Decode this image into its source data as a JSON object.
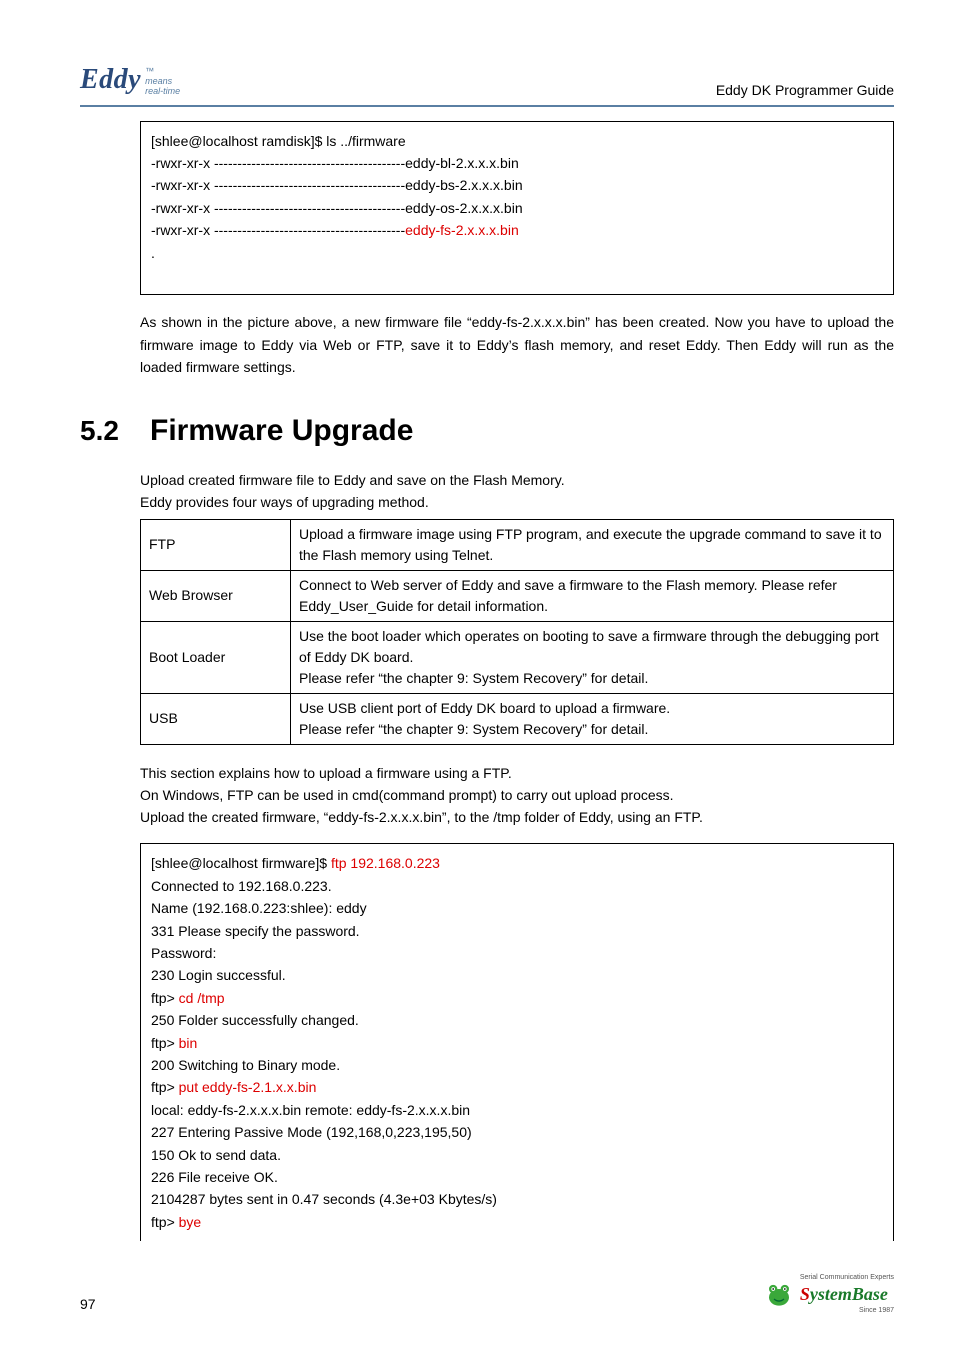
{
  "header": {
    "logo_main": "Eddy",
    "logo_tm": "™",
    "logo_sub1": "means",
    "logo_sub2": "real-time",
    "doc_title": "Eddy DK Programmer Guide"
  },
  "code1": {
    "l1": "[shlee@localhost ramdisk]$ ls ../firmware",
    "l2": "-rwxr-xr-x -----------------------------------------eddy-bl-2.x.x.x.bin",
    "l3": "-rwxr-xr-x -----------------------------------------eddy-bs-2.x.x.x.bin",
    "l4": "-rwxr-xr-x -----------------------------------------eddy-os-2.x.x.x.bin",
    "l5a": "-rwxr-xr-x -----------------------------------------",
    "l5b": "eddy-fs-2.x.x.x.bin",
    "l6": "."
  },
  "para1": "As shown in the picture above, a new firmware file “eddy-fs-2.x.x.x.bin” has been created. Now you have to upload the firmware image to Eddy via Web or FTP, save it to Eddy’s flash memory, and reset Eddy. Then Eddy will run as the loaded firmware settings.",
  "section": {
    "num": "5.2",
    "title": "Firmware Upgrade"
  },
  "intro1": "Upload created firmware file to Eddy and save on the Flash Memory.",
  "intro2": "Eddy provides four ways of upgrading method.",
  "table": {
    "r1k": "FTP",
    "r1v": "Upload a firmware image using FTP program, and execute the upgrade command to save it to the Flash memory using Telnet.",
    "r2k": "Web Browser",
    "r2v": "Connect to Web server of Eddy and save a firmware to the Flash memory. Please refer Eddy_User_Guide for detail information.",
    "r3k": "Boot Loader",
    "r3v": "Use the boot loader which operates on booting to save a firmware through the debugging port of Eddy DK board.\nPlease refer “the chapter 9: System Recovery” for detail.",
    "r4k": "USB",
    "r4v": "Use USB client port of Eddy DK board to upload a firmware.\nPlease refer “the chapter 9: System Recovery” for detail."
  },
  "after1": "This section explains how to upload a firmware using a FTP.",
  "after2": "On Windows, FTP can be used in cmd(command prompt) to carry out upload process.",
  "after3": "Upload the created firmware, “eddy-fs-2.x.x.x.bin”, to the /tmp folder of Eddy, using an FTP.",
  "code2": {
    "l1a": "[shlee@localhost firmware]$ ",
    "l1b": "ftp 192.168.0.223",
    "l2": "Connected to 192.168.0.223.",
    "l3": "Name (192.168.0.223:shlee): eddy",
    "l4": "331 Please specify the password.",
    "l5": "Password:",
    "l6": "230 Login successful.",
    "l7a": "ftp> ",
    "l7b": "cd /tmp",
    "l8": "250 Folder successfully changed.",
    "l9a": "ftp> ",
    "l9b": "bin",
    "l10": "200 Switching to Binary mode.",
    "l11a": "ftp> ",
    "l11b": "put eddy-fs-2.1.x.x.bin",
    "l12": "local: eddy-fs-2.x.x.x.bin remote: eddy-fs-2.x.x.x.bin",
    "l13": "227 Entering Passive Mode (192,168,0,223,195,50)",
    "l14": "150 Ok to send data.",
    "l15": "226 File receive OK.",
    "l16": "2104287 bytes sent in 0.47 seconds (4.3e+03 Kbytes/s)",
    "l17a": "ftp> ",
    "l17b": "bye"
  },
  "footer": {
    "page": "97",
    "sb_s": "S",
    "sb_rest": "ystemBase",
    "tag1": "Serial Communication Experts",
    "tag2": "Since 1987"
  }
}
